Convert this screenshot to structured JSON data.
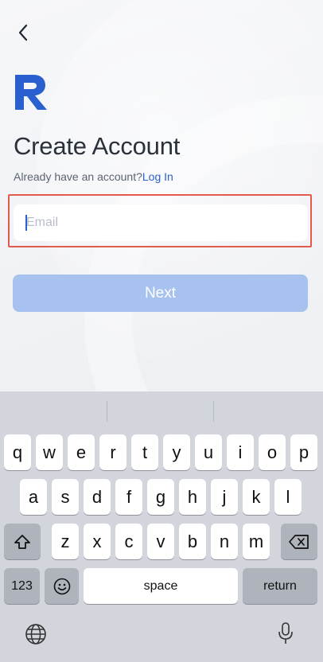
{
  "header": {
    "back_icon": "chevron-left-icon"
  },
  "logo": {
    "icon": "brand-r-logo",
    "color": "#2a5fd0"
  },
  "page": {
    "title": "Create Account",
    "subtitle_prefix": "Already have an account?",
    "login_link": "Log In"
  },
  "form": {
    "email_placeholder": "Email",
    "email_value": "",
    "next_label": "Next"
  },
  "colors": {
    "accent": "#2a5fd0",
    "next_disabled": "#a8c2ef",
    "highlight_border": "#e25b4d"
  },
  "keyboard": {
    "row1": [
      "q",
      "w",
      "e",
      "r",
      "t",
      "y",
      "u",
      "i",
      "o",
      "p"
    ],
    "row2": [
      "a",
      "s",
      "d",
      "f",
      "g",
      "h",
      "j",
      "k",
      "l"
    ],
    "row3": [
      "z",
      "x",
      "c",
      "v",
      "b",
      "n",
      "m"
    ],
    "numbers_label": "123",
    "space_label": "space",
    "return_label": "return",
    "shift_icon": "shift-icon",
    "delete_icon": "backspace-icon",
    "emoji_icon": "emoji-icon",
    "globe_icon": "globe-icon",
    "mic_icon": "microphone-icon"
  }
}
